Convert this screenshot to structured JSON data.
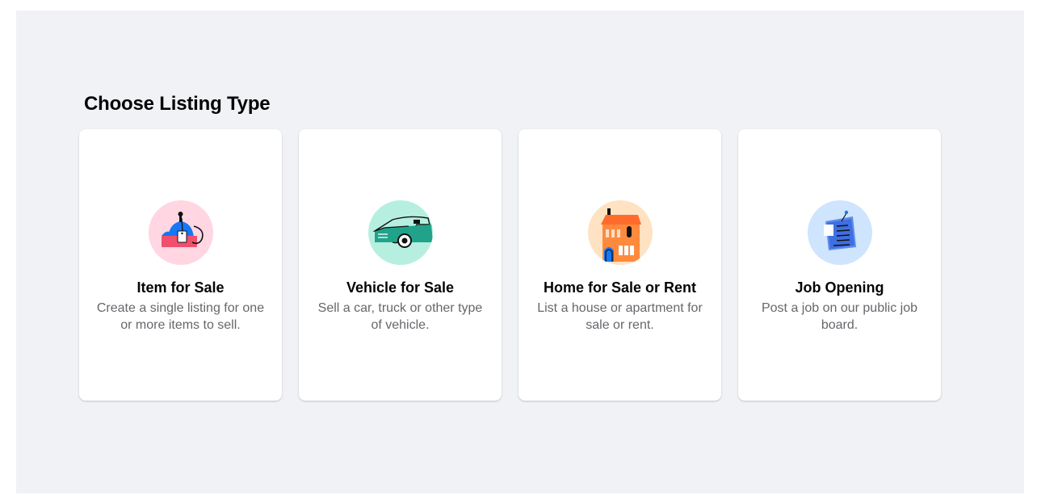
{
  "page": {
    "title": "Choose Listing Type"
  },
  "cards": [
    {
      "icon": "item-for-sale-icon",
      "icon_bg": "#ffd6e2",
      "title": "Item for Sale",
      "description": "Create a single listing for one or more items to sell."
    },
    {
      "icon": "vehicle-icon",
      "icon_bg": "#b6efe0",
      "title": "Vehicle for Sale",
      "description": "Sell a car, truck or other type of vehicle."
    },
    {
      "icon": "house-icon",
      "icon_bg": "#ffe2c2",
      "title": "Home for Sale or Rent",
      "description": "List a house or apartment for sale or rent."
    },
    {
      "icon": "job-board-icon",
      "icon_bg": "#cfe4fd",
      "title": "Job Opening",
      "description": "Post a job on our public job board."
    }
  ],
  "colors": {
    "background": "#f0f2f5",
    "card": "#ffffff",
    "title_text": "#050505",
    "secondary_text": "#65676b"
  }
}
